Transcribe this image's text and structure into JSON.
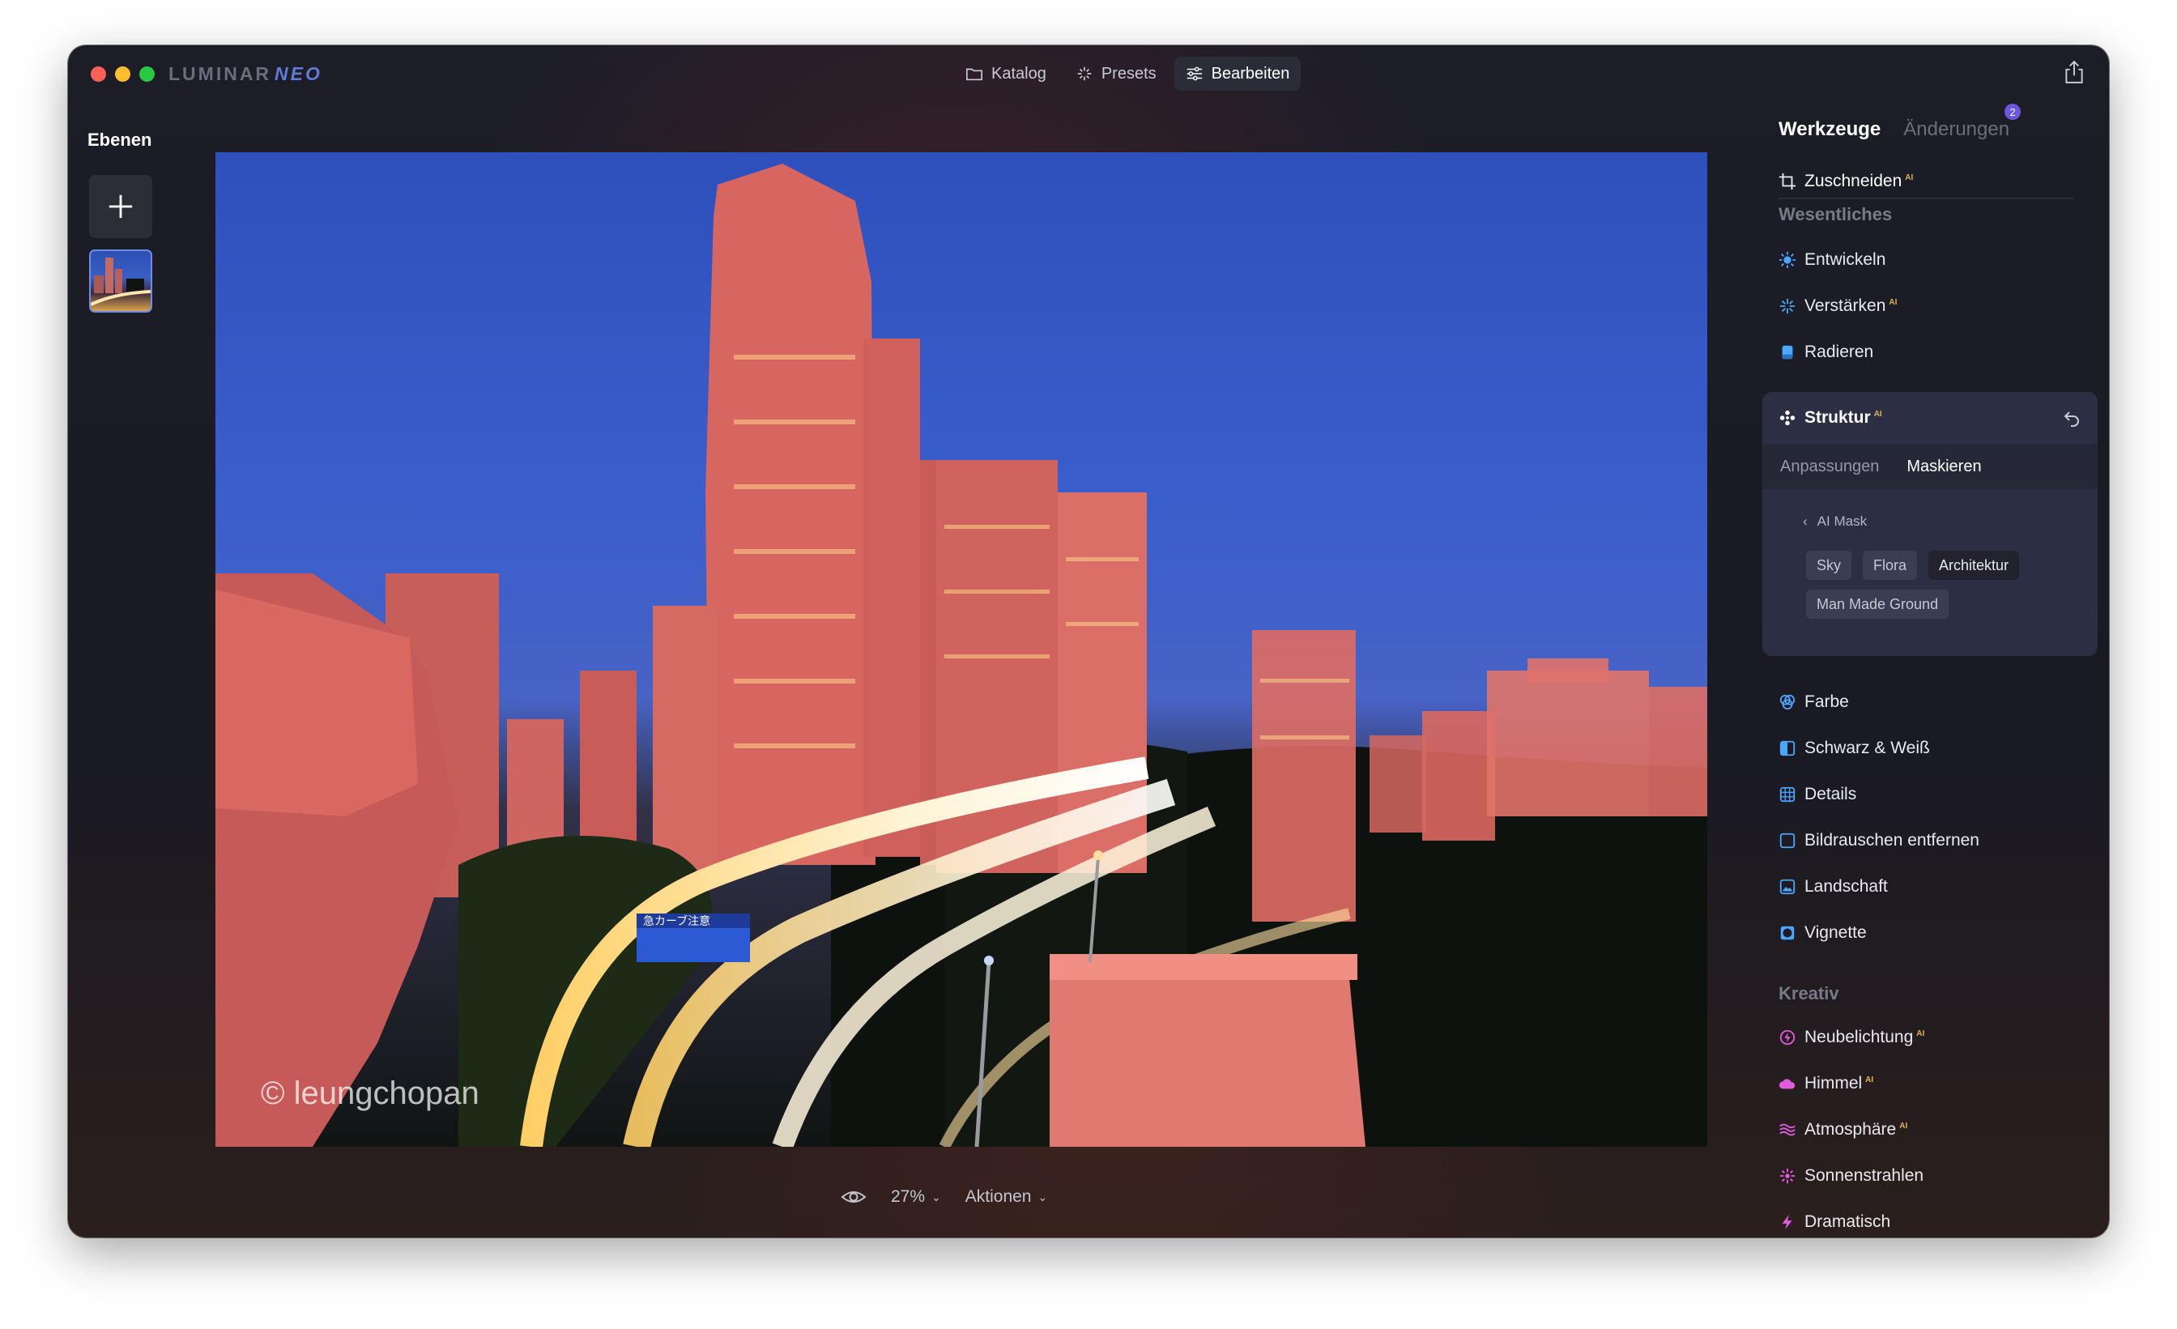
{
  "app": {
    "brand_main": "LUMINAR",
    "brand_accent": "NEO"
  },
  "modes": [
    {
      "label": "Katalog",
      "icon": "folder-icon"
    },
    {
      "label": "Presets",
      "icon": "presets-icon"
    },
    {
      "label": "Bearbeiten",
      "icon": "sliders-icon",
      "active": true
    }
  ],
  "layers": {
    "title": "Ebenen"
  },
  "canvas": {
    "watermark": "© leungchopan",
    "road_sign": "急カーブ注意"
  },
  "bottom": {
    "zoom": "27%",
    "actions": "Aktionen"
  },
  "panel": {
    "tab_tools": "Werkzeuge",
    "tab_changes": "Änderungen",
    "changes_count": "2",
    "crop": "Zuschneiden",
    "ai_tag": "AI",
    "section_essentials": "Wesentliches",
    "essentials": [
      {
        "label": "Entwickeln",
        "icon": "sun-icon",
        "ai": false
      },
      {
        "label": "Verstärken",
        "icon": "sparkle-icon",
        "ai": true
      },
      {
        "label": "Radieren",
        "icon": "eraser-icon",
        "ai": false
      }
    ],
    "structure": {
      "title": "Struktur",
      "tab_adjust": "Anpassungen",
      "tab_mask": "Maskieren",
      "ai_mask": "AI Mask",
      "chips": [
        "Sky",
        "Flora",
        "Architektur",
        "Man Made Ground"
      ],
      "selected_chip": "Architektur"
    },
    "essentials2": [
      {
        "label": "Farbe",
        "icon": "color-icon"
      },
      {
        "label": "Schwarz & Weiß",
        "icon": "bw-icon"
      },
      {
        "label": "Details",
        "icon": "details-icon"
      },
      {
        "label": "Bildrauschen entfernen",
        "icon": "denoise-icon"
      },
      {
        "label": "Landschaft",
        "icon": "landscape-icon"
      },
      {
        "label": "Vignette",
        "icon": "vignette-icon"
      }
    ],
    "section_creative": "Kreativ",
    "creative": [
      {
        "label": "Neubelichtung",
        "icon": "relight-icon",
        "ai": true
      },
      {
        "label": "Himmel",
        "icon": "cloud-icon",
        "ai": true
      },
      {
        "label": "Atmosphäre",
        "icon": "atmosphere-icon",
        "ai": true
      },
      {
        "label": "Sonnenstrahlen",
        "icon": "sunrays-icon",
        "ai": false
      },
      {
        "label": "Dramatisch",
        "icon": "bolt-icon",
        "ai": false
      }
    ]
  },
  "colors": {
    "accent": "#6c55e0",
    "mask_overlay": "#e06a62",
    "ai_tag": "#e0b44a"
  }
}
